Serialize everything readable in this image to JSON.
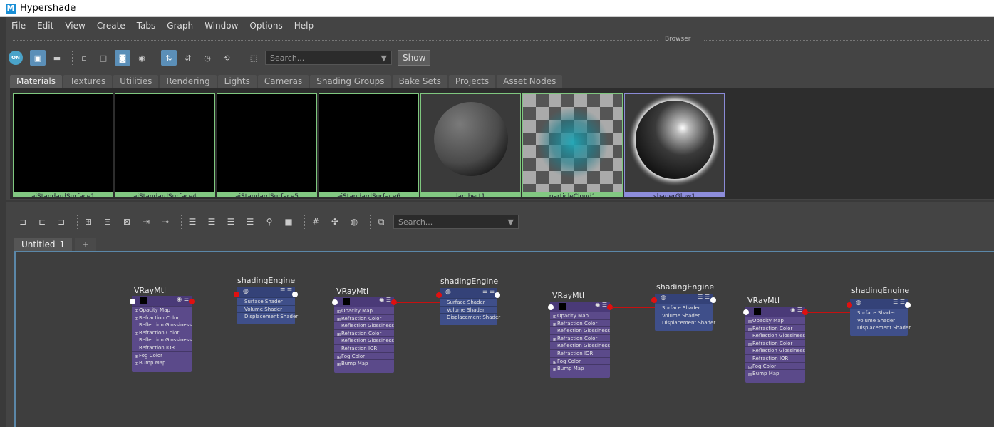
{
  "window": {
    "title": "Hypershade",
    "logo": "M"
  },
  "menu": [
    "File",
    "Edit",
    "View",
    "Create",
    "Tabs",
    "Graph",
    "Window",
    "Options",
    "Help"
  ],
  "browser": {
    "label": "Browser",
    "toolbar": {
      "on_label": "ON",
      "search_placeholder": "Search...",
      "show_label": "Show"
    },
    "tabs": [
      "Materials",
      "Textures",
      "Utilities",
      "Rendering",
      "Lights",
      "Cameras",
      "Shading Groups",
      "Bake Sets",
      "Projects",
      "Asset Nodes"
    ],
    "active_tab": "Materials",
    "swatches": [
      {
        "name": "aiStandardSurface1",
        "kind": "black"
      },
      {
        "name": "aiStandardSurface4",
        "kind": "black"
      },
      {
        "name": "aiStandardSurface5",
        "kind": "black"
      },
      {
        "name": "aiStandardSurface6",
        "kind": "black"
      },
      {
        "name": "lambert1",
        "kind": "lambert"
      },
      {
        "name": "particleCloud1",
        "kind": "particle"
      },
      {
        "name": "shaderGlow1",
        "kind": "glow"
      }
    ]
  },
  "graph": {
    "toolbar": {
      "search_placeholder": "Search..."
    },
    "tabs": [
      "Untitled_1",
      "+"
    ],
    "vray_title": "VRayMtl",
    "sg_title": "shadingEngine",
    "vray_attrs": [
      "Opacity Map",
      "Refraction Color",
      "Reflection Glossiness",
      "Refraction Color",
      "Reflection Glossiness",
      "Refraction IOR",
      "Fog Color",
      "Bump Map"
    ],
    "sg_attrs": [
      "Surface Shader",
      "Volume Shader",
      "Displacement Shader"
    ]
  },
  "colors": {
    "accent": "#5b8fb8",
    "vray_node": "#5b4a8a",
    "sg_node": "#3f4f8a",
    "connection": "#c61010",
    "swatch_border": "#7fc77f",
    "glow_border": "#8a8ad6"
  }
}
